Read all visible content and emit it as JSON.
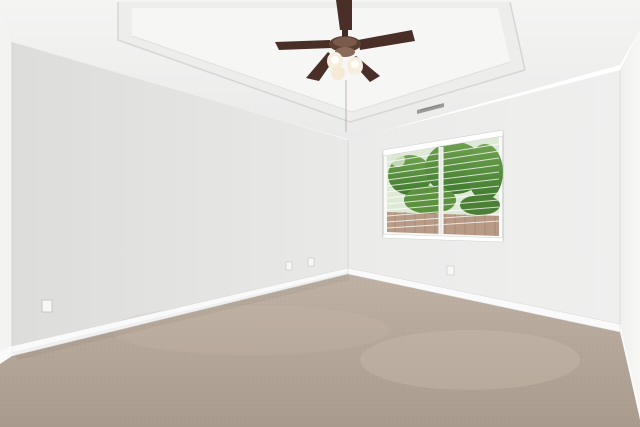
{
  "scene": {
    "kind": "photo of an empty room",
    "objects": [
      "tray-ceiling",
      "ceiling-fan-with-light-kit",
      "hvac-vent",
      "window-with-blinds",
      "carpet-floor",
      "baseboard-trim",
      "wall-outlet"
    ]
  },
  "palette": {
    "wall_left": "#e5e5e3",
    "wall_back": "#eeeeec",
    "wall_right": "#f3f3f2",
    "ceiling": "#f2f2f1",
    "carpet": "#b5a799",
    "trim": "#fafafa",
    "fan_blade": "#4a2f28",
    "foliage": "#4f8a3a"
  }
}
